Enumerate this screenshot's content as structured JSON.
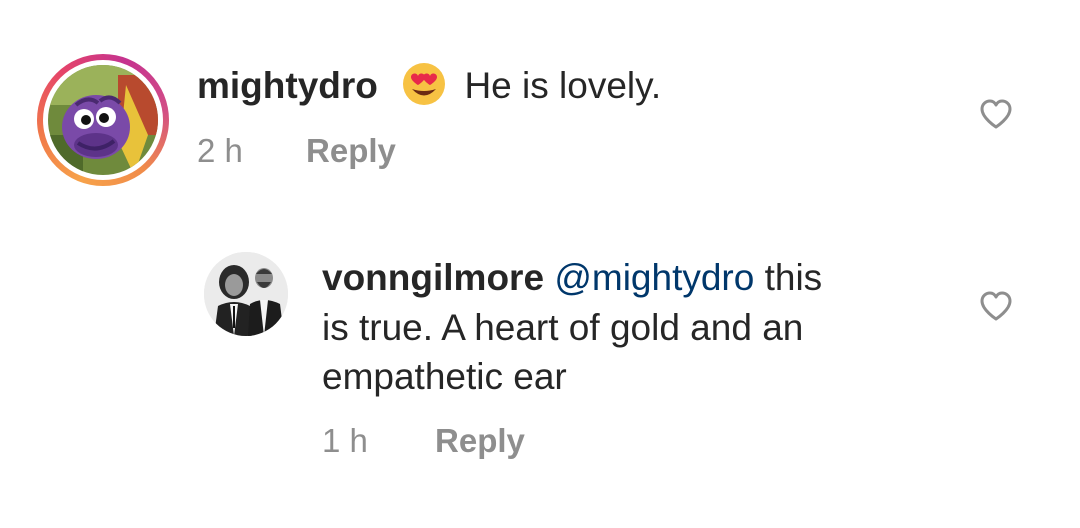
{
  "comments": [
    {
      "username": "mightydro",
      "emoji": "heart-eyes-emoji",
      "text": "He is lovely.",
      "time": "2 h",
      "reply_label": "Reply",
      "avatar": "purple-bug-character-avatar",
      "like_icon": "heart-outline-icon"
    },
    {
      "username": "vonngilmore",
      "mention": "@mightydro",
      "text_lines": [
        "this",
        "is true. A heart of gold and an",
        "empathetic ear"
      ],
      "time": "1 h",
      "reply_label": "Reply",
      "avatar": "two-men-photo-avatar",
      "like_icon": "heart-outline-icon"
    }
  ],
  "colors": {
    "text": "#262626",
    "mention": "#00376b",
    "muted": "#8e8e8e",
    "story_ring_start": "#f7a24a",
    "story_ring_end": "#c5338f"
  }
}
